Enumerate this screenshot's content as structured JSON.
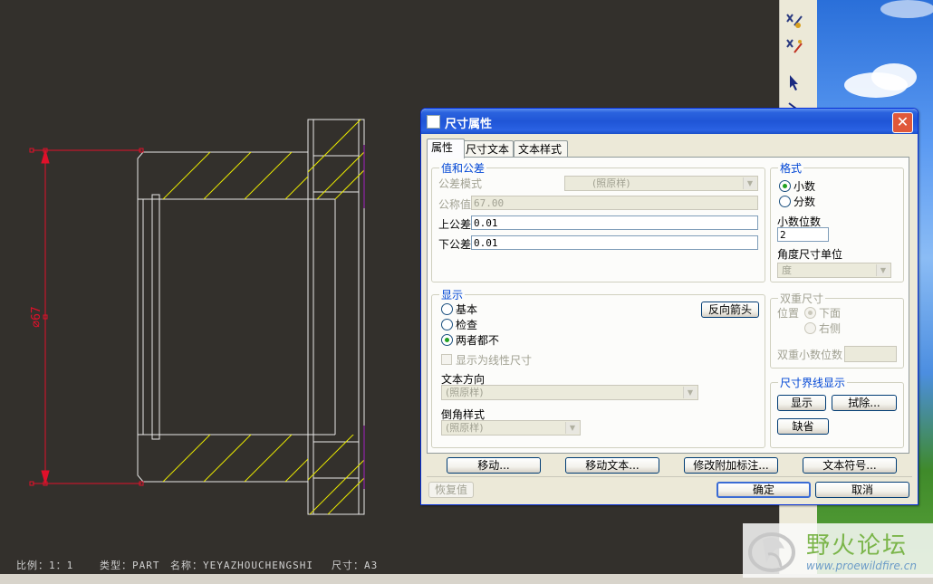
{
  "statusbar": {
    "scale": "比例：1：1",
    "type": "类型：PART",
    "name": "名称：YEYAZHOUCHENGSHI",
    "size": "尺寸：A3"
  },
  "drawing": {
    "dimension_text": "⌀67"
  },
  "watermark": {
    "title": "野火论坛",
    "url": "www.proewildfire.cn"
  },
  "dialog": {
    "title": "尺寸属性",
    "tabs": [
      "属性",
      "尺寸文本",
      "文本样式"
    ],
    "value_tolerance": {
      "legend": "值和公差",
      "tolerance_mode_label": "公差模式",
      "tolerance_mode_value": "(照原样)",
      "nominal_label": "公称值",
      "nominal_value": "67.00",
      "upper_label": "上公差",
      "upper_value": "0.01",
      "lower_label": "下公差",
      "lower_value": "0.01"
    },
    "format": {
      "legend": "格式",
      "decimal_label": "小数",
      "fraction_label": "分数",
      "decimal_places_label": "小数位数",
      "decimal_places_value": "2",
      "angle_unit_label": "角度尺寸单位",
      "angle_unit_value": "度"
    },
    "display": {
      "legend": "显示",
      "basic_label": "基本",
      "inspect_label": "检查",
      "neither_label": "两者都不",
      "reverse_arrow_label": "反向箭头",
      "linear_label": "显示为线性尺寸",
      "text_direction_label": "文本方向",
      "text_direction_value": "(照原样)",
      "chamfer_label": "倒角样式",
      "chamfer_value": "(照原样)"
    },
    "dual": {
      "legend": "双重尺寸",
      "position_label": "位置",
      "below_label": "下面",
      "right_label": "右侧",
      "dual_decimal_label": "双重小数位数"
    },
    "witness": {
      "legend": "尺寸界线显示",
      "show_label": "显示",
      "erase_label": "拭除...",
      "default_label": "缺省"
    },
    "actions": {
      "move": "移动...",
      "move_text": "移动文本...",
      "modify_note": "修改附加标注...",
      "text_symbol": "文本符号..."
    },
    "footer": {
      "restore": "恢复值",
      "ok": "确定",
      "cancel": "取消"
    }
  }
}
